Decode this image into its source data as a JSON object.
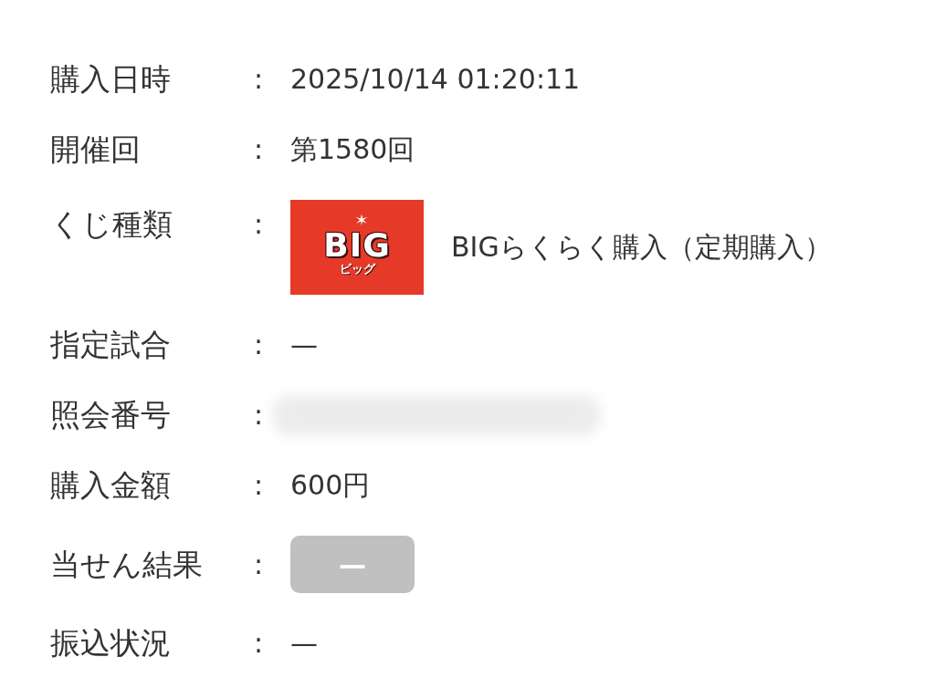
{
  "rows": [
    {
      "label": "購入日時",
      "separator": ":",
      "kind": "text",
      "value": "2025/10/14 01:20:11"
    },
    {
      "label": "開催回",
      "separator": ":",
      "kind": "text",
      "value": "第1580回"
    },
    {
      "label": "くじ種類",
      "separator": ":",
      "kind": "lottery",
      "logo": {
        "title": "BIG",
        "reading": "ビッグ"
      },
      "value": "BIGらくらく購入（定期購入）"
    },
    {
      "label": "指定試合",
      "separator": ":",
      "kind": "text",
      "value": "—"
    },
    {
      "label": "照会番号",
      "separator": ":",
      "kind": "redacted"
    },
    {
      "label": "購入金額",
      "separator": ":",
      "kind": "text",
      "value": "600円"
    },
    {
      "label": "当せん結果",
      "separator": ":",
      "kind": "badge",
      "value": "—"
    },
    {
      "label": "振込状況",
      "separator": ":",
      "kind": "text",
      "value": "—"
    }
  ]
}
